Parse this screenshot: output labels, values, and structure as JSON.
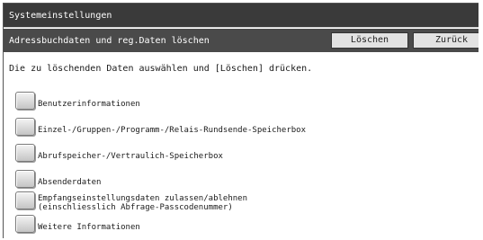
{
  "window": {
    "title": "Systemeinstellungen"
  },
  "header": {
    "subtitle": "Adressbuchdaten und reg.Daten löschen",
    "delete_label": "Löschen",
    "back_label": "Zurück"
  },
  "instruction": "Die zu löschenden Daten auswählen und [Löschen] drücken.",
  "options": [
    {
      "label": "Benutzerinformationen",
      "checked": false
    },
    {
      "label": "Einzel-/Gruppen-/Programm-/Relais-Rundsende-Speicherbox",
      "checked": false
    },
    {
      "label": "Abrufspeicher-/Vertraulich-Speicherbox",
      "checked": false
    },
    {
      "label": "Absenderdaten",
      "checked": false
    },
    {
      "label_line1": "Empfangseinstellungsdaten zulassen/ablehnen",
      "label_line2": "(einschliesslich Abfrage-Passcodenummer)",
      "checked": false
    },
    {
      "label": "Weitere Informationen",
      "checked": false
    }
  ]
}
